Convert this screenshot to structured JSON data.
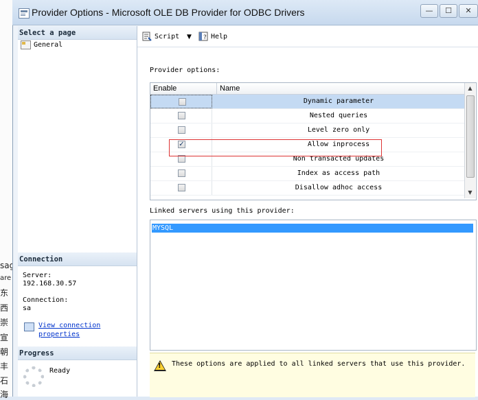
{
  "window": {
    "title": "Provider Options - Microsoft OLE DB Provider for ODBC Drivers",
    "min_glyph": "—",
    "max_glyph": "☐",
    "close_glyph": "✕"
  },
  "background_strip": [
    "sag",
    "are",
    "东",
    "西",
    "崇",
    "宣",
    "朝",
    "丰",
    "石",
    "海"
  ],
  "left_pane": {
    "select_page_header": "Select a page",
    "pages": [
      {
        "label": "General",
        "icon": "page-settings-icon"
      }
    ],
    "connection_header": "Connection",
    "server_label": "Server:",
    "server_value": "192.168.30.57",
    "connection_label": "Connection:",
    "connection_value": "sa",
    "view_link_line1": "View connection",
    "view_link_line2": "properties",
    "progress_header": "Progress",
    "progress_status": "Ready"
  },
  "toolbar": {
    "script_label": "Script",
    "help_label": "Help"
  },
  "provider_options": {
    "section_label": "Provider options:",
    "col_enable": "Enable",
    "col_name": "Name",
    "rows": [
      {
        "name": "Dynamic parameter",
        "checked": false,
        "selected": true
      },
      {
        "name": "Nested queries",
        "checked": false,
        "selected": false
      },
      {
        "name": "Level zero only",
        "checked": false,
        "selected": false
      },
      {
        "name": "Allow inprocess",
        "checked": true,
        "selected": false
      },
      {
        "name": "Non transacted updates",
        "checked": false,
        "selected": false
      },
      {
        "name": "Index as access path",
        "checked": false,
        "selected": false
      },
      {
        "name": "Disallow adhoc access",
        "checked": false,
        "selected": false
      }
    ]
  },
  "linked_servers": {
    "section_label": "Linked servers using this provider:",
    "items": [
      "MYSQL"
    ]
  },
  "info_message": "These options are applied to all linked servers that use this provider.",
  "colors": {
    "selection": "#3399ff",
    "link": "#0033cc",
    "highlight_border": "#dd3333",
    "info_background": "#fffde1"
  }
}
